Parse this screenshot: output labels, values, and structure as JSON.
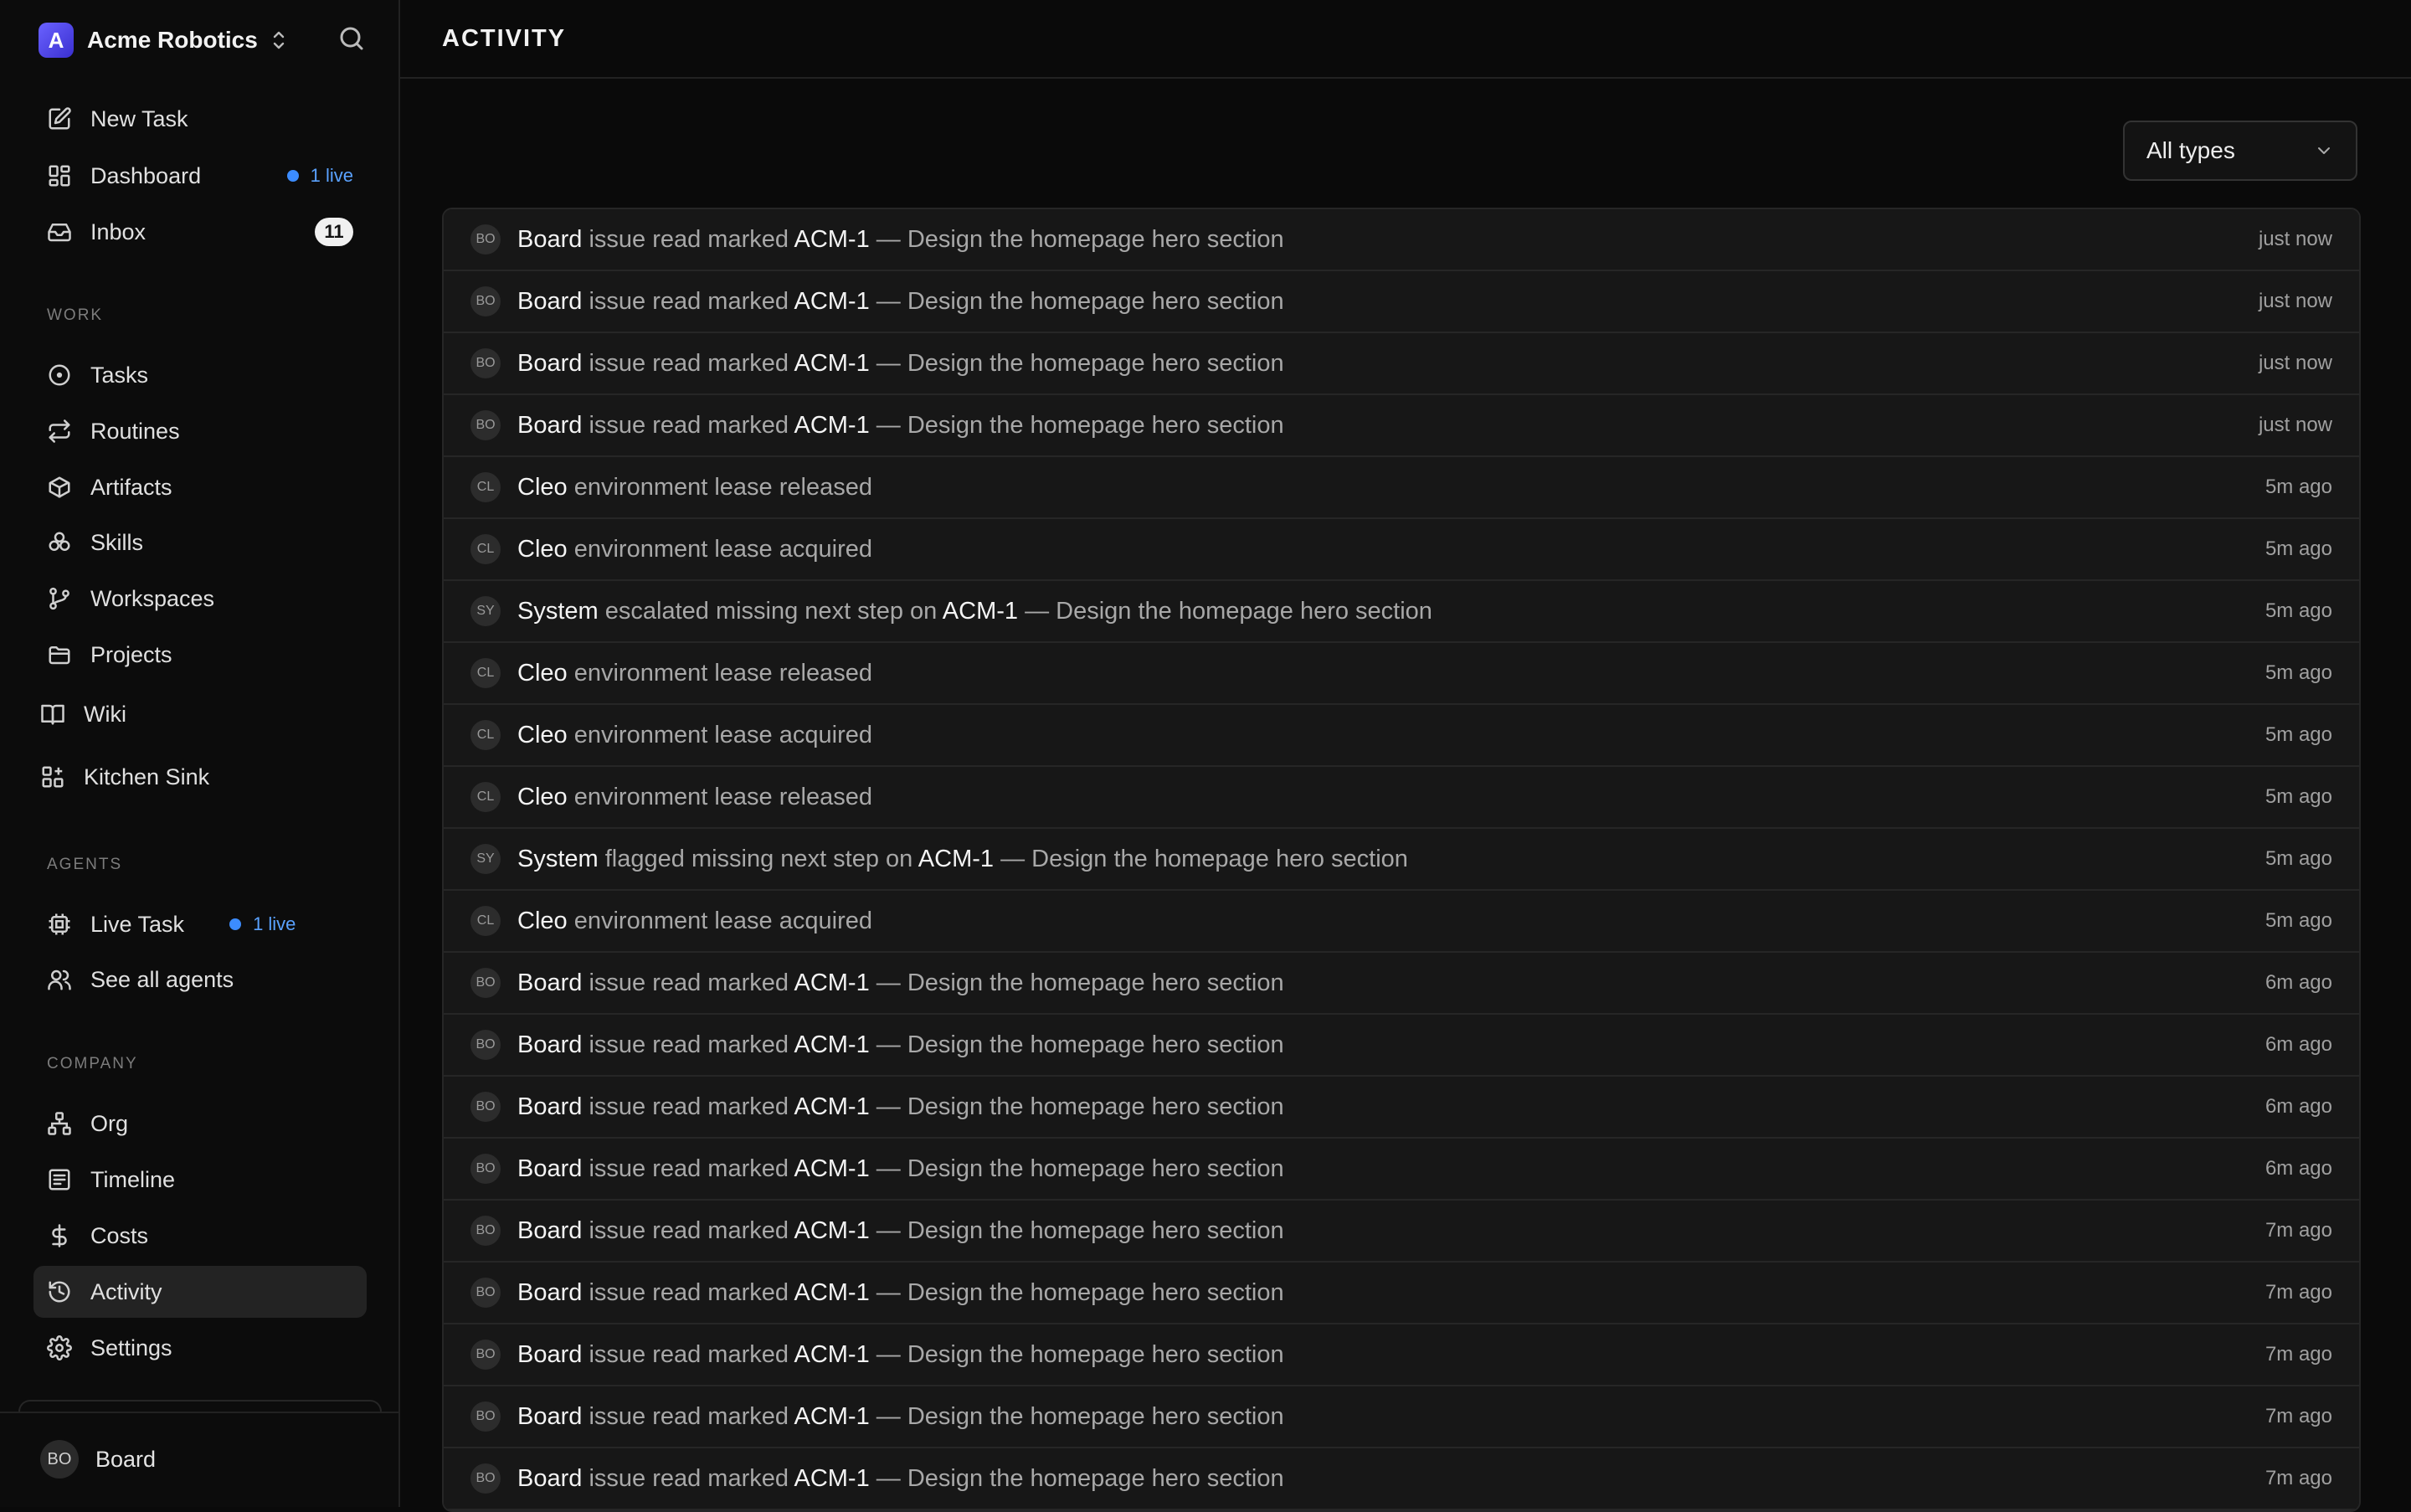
{
  "workspace": {
    "name": "Acme Robotics",
    "logo_letter": "A"
  },
  "nav_main": [
    {
      "label": "New Task",
      "icon": "edit-icon"
    },
    {
      "label": "Dashboard",
      "icon": "dashboard-icon",
      "live": "1 live"
    },
    {
      "label": "Inbox",
      "icon": "inbox-icon",
      "count": "11"
    }
  ],
  "sections": {
    "work": "WORK",
    "agents": "AGENTS",
    "company": "COMPANY"
  },
  "nav_work": [
    {
      "label": "Tasks",
      "icon": "circle-dot-icon"
    },
    {
      "label": "Routines",
      "icon": "repeat-icon"
    },
    {
      "label": "Artifacts",
      "icon": "package-icon"
    },
    {
      "label": "Skills",
      "icon": "boxes-icon"
    },
    {
      "label": "Workspaces",
      "icon": "git-branch-icon"
    },
    {
      "label": "Projects",
      "icon": "folder-icon"
    },
    {
      "label": "Wiki",
      "icon": "book-icon"
    },
    {
      "label": "Kitchen Sink",
      "icon": "grid-plus-icon"
    }
  ],
  "nav_agents": [
    {
      "label": "Live Task",
      "icon": "cpu-icon",
      "live": "1 live"
    },
    {
      "label": "See all agents",
      "icon": "users-icon"
    }
  ],
  "nav_company": [
    {
      "label": "Org",
      "icon": "org-chart-icon"
    },
    {
      "label": "Timeline",
      "icon": "timeline-icon"
    },
    {
      "label": "Costs",
      "icon": "dollar-icon"
    },
    {
      "label": "Activity",
      "icon": "history-icon",
      "active": true
    },
    {
      "label": "Settings",
      "icon": "gear-icon"
    }
  ],
  "user": {
    "initials": "BO",
    "name": "Board"
  },
  "page": {
    "title": "ACTIVITY"
  },
  "filter": {
    "selected": "All types"
  },
  "activity": [
    {
      "avatar": "BO",
      "actor": "Board",
      "action": "issue read marked",
      "ref": "ACM-1",
      "detail": "— Design the homepage hero section",
      "time": "just now"
    },
    {
      "avatar": "BO",
      "actor": "Board",
      "action": "issue read marked",
      "ref": "ACM-1",
      "detail": "— Design the homepage hero section",
      "time": "just now"
    },
    {
      "avatar": "BO",
      "actor": "Board",
      "action": "issue read marked",
      "ref": "ACM-1",
      "detail": "— Design the homepage hero section",
      "time": "just now"
    },
    {
      "avatar": "BO",
      "actor": "Board",
      "action": "issue read marked",
      "ref": "ACM-1",
      "detail": "— Design the homepage hero section",
      "time": "just now"
    },
    {
      "avatar": "CL",
      "actor": "Cleo",
      "action": "environment lease released",
      "ref": "",
      "detail": "",
      "time": "5m ago"
    },
    {
      "avatar": "CL",
      "actor": "Cleo",
      "action": "environment lease acquired",
      "ref": "",
      "detail": "",
      "time": "5m ago"
    },
    {
      "avatar": "SY",
      "actor": "System",
      "action": "escalated missing next step on",
      "ref": "ACM-1",
      "detail": "— Design the homepage hero section",
      "time": "5m ago"
    },
    {
      "avatar": "CL",
      "actor": "Cleo",
      "action": "environment lease released",
      "ref": "",
      "detail": "",
      "time": "5m ago"
    },
    {
      "avatar": "CL",
      "actor": "Cleo",
      "action": "environment lease acquired",
      "ref": "",
      "detail": "",
      "time": "5m ago"
    },
    {
      "avatar": "CL",
      "actor": "Cleo",
      "action": "environment lease released",
      "ref": "",
      "detail": "",
      "time": "5m ago"
    },
    {
      "avatar": "SY",
      "actor": "System",
      "action": "flagged missing next step on",
      "ref": "ACM-1",
      "detail": "— Design the homepage hero section",
      "time": "5m ago"
    },
    {
      "avatar": "CL",
      "actor": "Cleo",
      "action": "environment lease acquired",
      "ref": "",
      "detail": "",
      "time": "5m ago"
    },
    {
      "avatar": "BO",
      "actor": "Board",
      "action": "issue read marked",
      "ref": "ACM-1",
      "detail": "— Design the homepage hero section",
      "time": "6m ago"
    },
    {
      "avatar": "BO",
      "actor": "Board",
      "action": "issue read marked",
      "ref": "ACM-1",
      "detail": "— Design the homepage hero section",
      "time": "6m ago"
    },
    {
      "avatar": "BO",
      "actor": "Board",
      "action": "issue read marked",
      "ref": "ACM-1",
      "detail": "— Design the homepage hero section",
      "time": "6m ago"
    },
    {
      "avatar": "BO",
      "actor": "Board",
      "action": "issue read marked",
      "ref": "ACM-1",
      "detail": "— Design the homepage hero section",
      "time": "6m ago"
    },
    {
      "avatar": "BO",
      "actor": "Board",
      "action": "issue read marked",
      "ref": "ACM-1",
      "detail": "— Design the homepage hero section",
      "time": "7m ago"
    },
    {
      "avatar": "BO",
      "actor": "Board",
      "action": "issue read marked",
      "ref": "ACM-1",
      "detail": "— Design the homepage hero section",
      "time": "7m ago"
    },
    {
      "avatar": "BO",
      "actor": "Board",
      "action": "issue read marked",
      "ref": "ACM-1",
      "detail": "— Design the homepage hero section",
      "time": "7m ago"
    },
    {
      "avatar": "BO",
      "actor": "Board",
      "action": "issue read marked",
      "ref": "ACM-1",
      "detail": "— Design the homepage hero section",
      "time": "7m ago"
    },
    {
      "avatar": "BO",
      "actor": "Board",
      "action": "issue read marked",
      "ref": "ACM-1",
      "detail": "— Design the homepage hero section",
      "time": "7m ago"
    }
  ]
}
